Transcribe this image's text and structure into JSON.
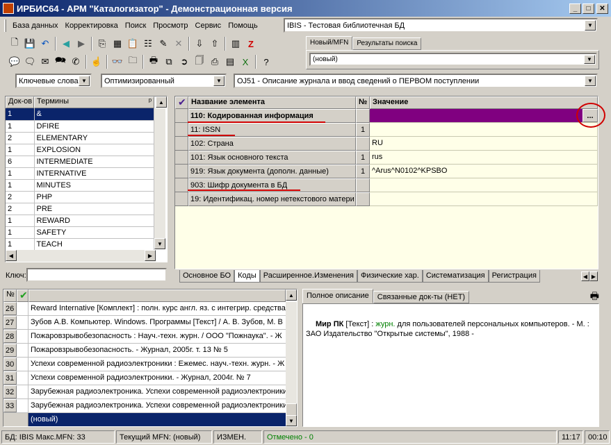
{
  "window": {
    "title": "ИРБИС64 - АРМ \"Каталогизатор\" - Демонстрационная версия"
  },
  "menu": [
    "База данных",
    "Корректировка",
    "Поиск",
    "Просмотр",
    "Сервис",
    "Помощь"
  ],
  "database_select": "IBIS - Тестовая библиотечная БД",
  "top_tabs": [
    "Новый/MFN",
    "Результаты поиска"
  ],
  "record_select": "(новый)",
  "filters": {
    "index_select": "Ключевые слова",
    "mode_select": "Оптимизированный",
    "worksheet_select": "OJ51 - Описание журнала и ввод сведений о ПЕРВОМ поступлении"
  },
  "terms": {
    "headers": [
      "Док-ов",
      "Термины"
    ],
    "rows": [
      [
        "1",
        "&"
      ],
      [
        "1",
        "DFIRE"
      ],
      [
        "2",
        "ELEMENTARY"
      ],
      [
        "1",
        "EXPLOSION"
      ],
      [
        "6",
        "INTERMEDIATE"
      ],
      [
        "1",
        "INTERNATIVE"
      ],
      [
        "1",
        "MINUTES"
      ],
      [
        "2",
        "PHP"
      ],
      [
        "2",
        "PRE"
      ],
      [
        "1",
        "REWARD"
      ],
      [
        "1",
        "SAFETY"
      ],
      [
        "1",
        "TEACH"
      ]
    ],
    "key_label": "Ключ:"
  },
  "worksheet": {
    "headers": [
      "Название элемента",
      "№",
      "Значение"
    ],
    "rows": [
      {
        "name": "110: Кодированная информация",
        "num": "",
        "value": ""
      },
      {
        "name": "11: ISSN",
        "num": "1",
        "value": ""
      },
      {
        "name": "102: Страна",
        "num": "",
        "value": "RU"
      },
      {
        "name": "101: Язык основного текста",
        "num": "1",
        "value": "rus"
      },
      {
        "name": "919: Язык документа (дополн. данные)",
        "num": "1",
        "value": "^Arus^N0102^KPSBO"
      },
      {
        "name": "903: Шифр документа в БД",
        "num": "",
        "value": ""
      },
      {
        "name": "19: Идентификац. номер нетекстового матери",
        "num": "",
        "value": ""
      }
    ],
    "ellipsis": "...",
    "tabs": [
      "Основное БО",
      "Коды",
      "Расширенное.Изменения",
      "Физические хар.",
      "Систематизация",
      "Регистрация"
    ]
  },
  "records": {
    "header_num": "№",
    "rows": [
      [
        "26",
        "Reward Internative [Комплект] : полн. курс англ. яз. с интегрир. средства"
      ],
      [
        "27",
        "Зубов А.В. Компьютер. Windows. Программы [Текст] / А. В. Зубов, М. В"
      ],
      [
        "28",
        "Пожаровзрывобезопасность : Науч.-техн. журн. / ООО \"Пожнаука\". - Ж"
      ],
      [
        "29",
        "Пожаровзрывобезопасность. - Журнал, 2005г. т. 13 № 5"
      ],
      [
        "30",
        "Успехи современной радиоэлектроники : Ежемес. науч.-техн. журн. - Ж"
      ],
      [
        "31",
        "Успехи современной радиоэлектроники. - Журнал, 2004г. № 7"
      ],
      [
        "32",
        "Зарубежная радиоэлектроника. Успехи современной радиоэлектроники"
      ],
      [
        "33",
        "Зарубежная радиоэлектроника. Успехи современной радиоэлектроники"
      ]
    ],
    "new_row": "(новый)"
  },
  "description": {
    "tabs": [
      "Полное описание",
      "Связанные док-ты (НЕТ)"
    ],
    "title_bold": "Мир ПК",
    "part1": " [Текст] : ",
    "green_word": "журн.",
    "part2": " для пользователей персональных компьютеров. - М. : ЗАО Издательство \"Открытые системы\", 1988 -"
  },
  "status": {
    "db": "БД: IBIS Макс.MFN: 33",
    "current": "Текущий MFN: (новый)",
    "changed": "ИЗМЕН.",
    "marked": "Отмечено - 0",
    "time": "11:17",
    "time2": "00:10"
  },
  "colors": {
    "selection": "#0a246a",
    "purple_highlight": "#800080",
    "annotation_red": "#d00000",
    "field_bg": "#ffffe8",
    "green_text": "#008000"
  }
}
